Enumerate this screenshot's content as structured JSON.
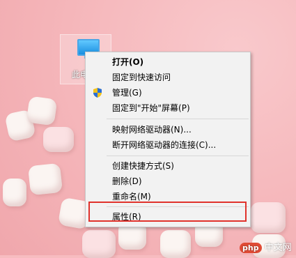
{
  "desktop": {
    "icon_label": "此电"
  },
  "context_menu": {
    "items": [
      {
        "label": "打开(O)",
        "bold": true
      },
      {
        "label": "固定到快速访问"
      },
      {
        "label": "管理(G)",
        "icon": "uac-shield-icon"
      },
      {
        "label": "固定到\"开始\"屏幕(P)"
      },
      {
        "label": "映射网络驱动器(N)..."
      },
      {
        "label": "断开网络驱动器的连接(C)..."
      },
      {
        "label": "创建快捷方式(S)"
      },
      {
        "label": "删除(D)"
      },
      {
        "label": "重命名(M)"
      },
      {
        "label": "属性(R)"
      }
    ]
  },
  "highlight_color": "#e0322b",
  "watermark": {
    "logo": "php",
    "text": "中文网"
  }
}
